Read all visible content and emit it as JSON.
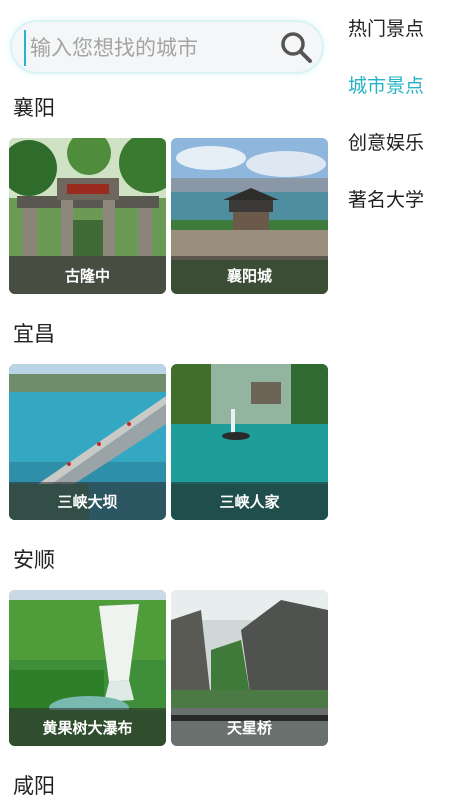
{
  "search": {
    "placeholder": "输入您想找的城市"
  },
  "side_nav": {
    "items": [
      {
        "label": "热门景点",
        "active": false
      },
      {
        "label": "城市景点",
        "active": true
      },
      {
        "label": "创意娱乐",
        "active": false
      },
      {
        "label": "著名大学",
        "active": false
      }
    ],
    "active_color": "#25b3c5"
  },
  "sections": [
    {
      "city": "襄阳",
      "spots": [
        {
          "name": "古隆中",
          "scene": "archway"
        },
        {
          "name": "襄阳城",
          "scene": "city-gate"
        }
      ]
    },
    {
      "city": "宜昌",
      "spots": [
        {
          "name": "三峡大坝",
          "scene": "dam"
        },
        {
          "name": "三峡人家",
          "scene": "gorge-river"
        }
      ]
    },
    {
      "city": "安顺",
      "spots": [
        {
          "name": "黄果树大瀑布",
          "scene": "waterfall"
        },
        {
          "name": "天星桥",
          "scene": "karst-rocks"
        }
      ]
    },
    {
      "city": "咸阳",
      "spots": []
    }
  ]
}
